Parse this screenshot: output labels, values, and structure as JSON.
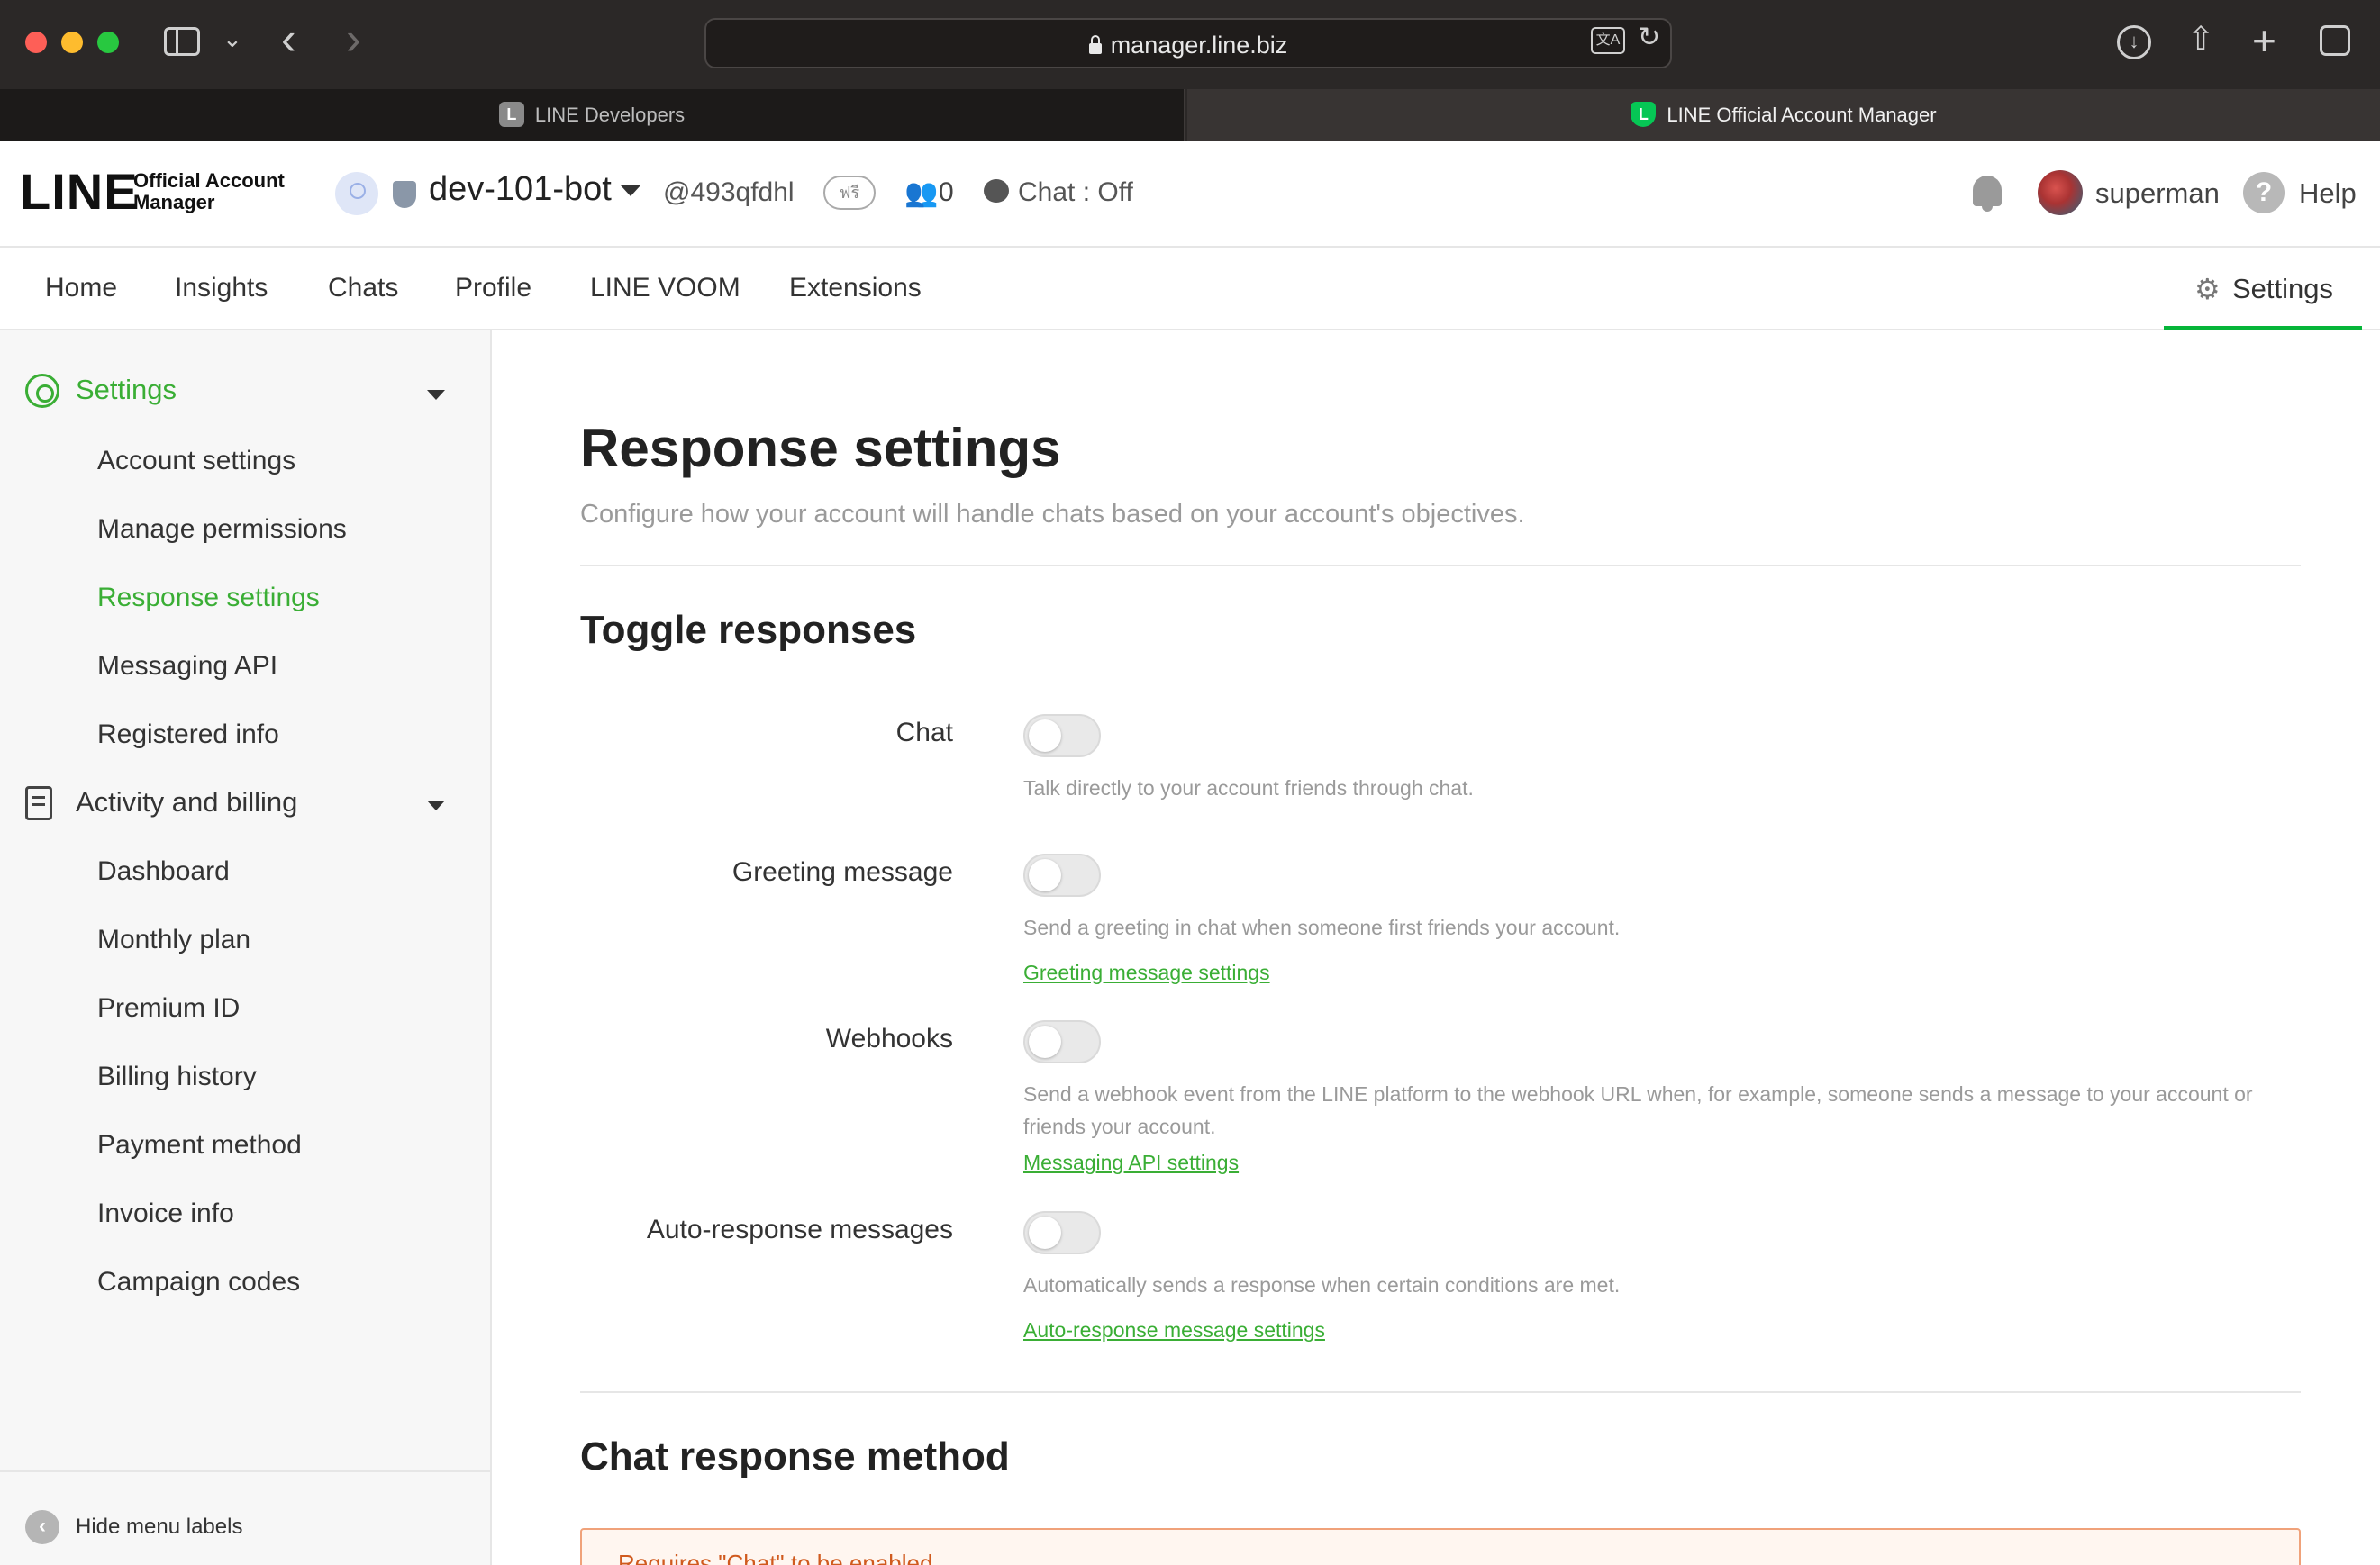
{
  "browser": {
    "url": "manager.line.biz",
    "tabs": [
      {
        "label": "LINE Developers",
        "favicon": "L",
        "active": false
      },
      {
        "label": "LINE Official Account Manager",
        "favicon": "L",
        "active": true
      }
    ]
  },
  "header": {
    "logo_main": "LINE",
    "logo_sub_1": "Official Account",
    "logo_sub_2": "Manager",
    "account_name": "dev-101-bot",
    "account_id": "@493qfdhl",
    "plan_badge": "ฟรี",
    "friends_count": "0",
    "chat_status": "Chat : Off",
    "user_name": "superman",
    "help_label": "Help"
  },
  "nav": {
    "items": [
      "Home",
      "Insights",
      "Chats",
      "Profile",
      "LINE VOOM",
      "Extensions"
    ],
    "settings_label": "Settings"
  },
  "sidebar": {
    "settings_label": "Settings",
    "settings_items": [
      "Account settings",
      "Manage permissions",
      "Response settings",
      "Messaging API",
      "Registered info"
    ],
    "activity_label": "Activity and billing",
    "activity_items": [
      "Dashboard",
      "Monthly plan",
      "Premium ID",
      "Billing history",
      "Payment method",
      "Invoice info",
      "Campaign codes"
    ],
    "footer_label": "Hide menu labels"
  },
  "main": {
    "title": "Response settings",
    "description": "Configure how your account will handle chats based on your account's objectives.",
    "toggle_section_title": "Toggle responses",
    "rows": [
      {
        "label": "Chat",
        "enabled": false,
        "description": "Talk directly to your account friends through chat.",
        "link": ""
      },
      {
        "label": "Greeting message",
        "enabled": false,
        "description": "Send a greeting in chat when someone first friends your account.",
        "link": "Greeting message settings"
      },
      {
        "label": "Webhooks",
        "enabled": false,
        "description": "Send a webhook event from the LINE platform to the webhook URL when, for example, someone sends a message to your account or friends your account.",
        "link": "Messaging API settings"
      },
      {
        "label": "Auto-response messages",
        "enabled": false,
        "description": "Automatically sends a response when certain conditions are met.",
        "link": "Auto-response message settings"
      }
    ],
    "chat_section_title": "Chat response method",
    "alert_text": "Requires \"Chat\" to be enabled."
  },
  "colors": {
    "accent_green": "#3aae35",
    "nav_underline": "#06b539",
    "alert_border": "#f0a27a"
  }
}
